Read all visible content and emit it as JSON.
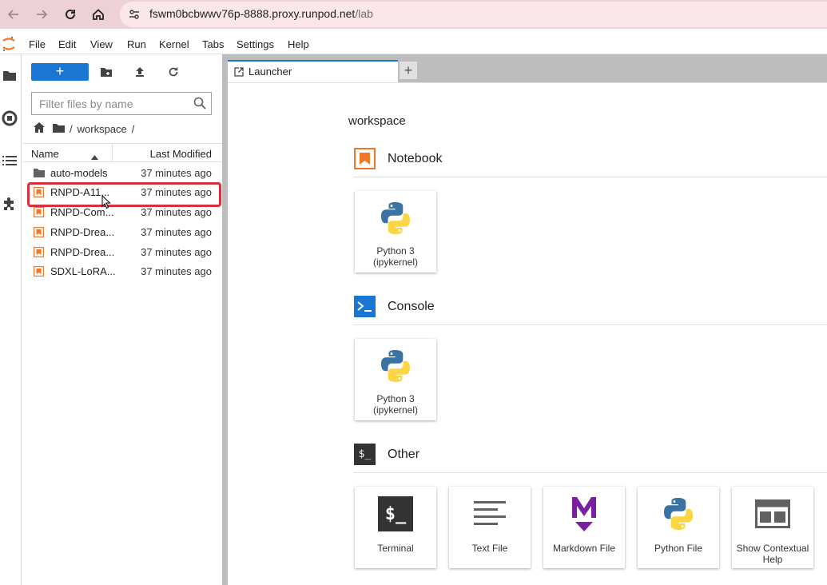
{
  "browser": {
    "url_host": "fswm0bcbwwv76p-8888.proxy.runpod.net",
    "url_path": "/lab"
  },
  "menu": [
    "File",
    "Edit",
    "View",
    "Run",
    "Kernel",
    "Tabs",
    "Settings",
    "Help"
  ],
  "filebrowser": {
    "new_label": "+",
    "filter_placeholder": "Filter files by name",
    "breadcrumb_sep": "/",
    "breadcrumb_folder": "workspace",
    "header_name": "Name",
    "header_modified": "Last Modified",
    "files": [
      {
        "name": "auto-models",
        "modified": "37 minutes ago",
        "type": "folder"
      },
      {
        "name": "RNPD-A11...",
        "modified": "37 minutes ago",
        "type": "notebook"
      },
      {
        "name": "RNPD-Com...",
        "modified": "37 minutes ago",
        "type": "notebook"
      },
      {
        "name": "RNPD-Drea...",
        "modified": "37 minutes ago",
        "type": "notebook"
      },
      {
        "name": "RNPD-Drea...",
        "modified": "37 minutes ago",
        "type": "notebook"
      },
      {
        "name": "SDXL-LoRA...",
        "modified": "37 minutes ago",
        "type": "notebook"
      }
    ]
  },
  "tabs": [
    {
      "label": "Launcher"
    }
  ],
  "launcher": {
    "workspace": "workspace",
    "sections": {
      "notebook": {
        "title": "Notebook",
        "cards": [
          {
            "line1": "Python 3",
            "line2": "(ipykernel)"
          }
        ]
      },
      "console": {
        "title": "Console",
        "cards": [
          {
            "line1": "Python 3",
            "line2": "(ipykernel)"
          }
        ]
      },
      "other": {
        "title": "Other",
        "icon_text": "$_",
        "cards": [
          {
            "line1": "Terminal",
            "line2": "",
            "icon_text": "$_"
          },
          {
            "line1": "Text File",
            "line2": ""
          },
          {
            "line1": "Markdown File",
            "line2": ""
          },
          {
            "line1": "Python File",
            "line2": ""
          },
          {
            "line1": "Show Contextual",
            "line2": "Help"
          }
        ]
      }
    }
  },
  "colors": {
    "accent": "#1976d2",
    "notebook_orange": "#f37626",
    "highlight_red": "#d7313f",
    "markdown_purple": "#7b1fa2"
  }
}
